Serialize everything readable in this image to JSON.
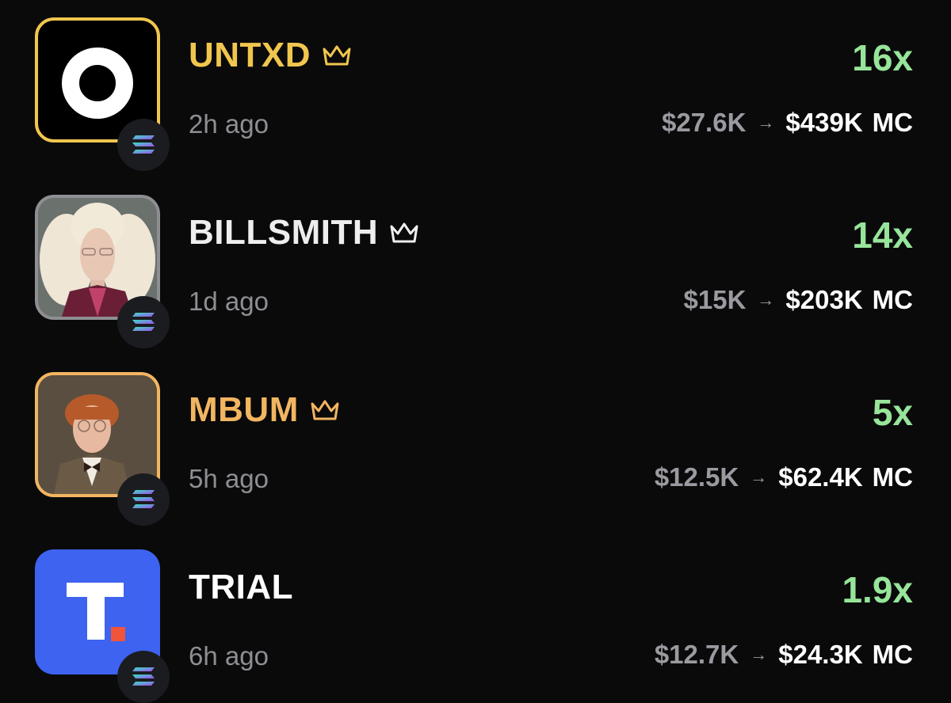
{
  "colors": {
    "gold": "#f0c64e",
    "orange": "#f2b560",
    "green": "#97e59a",
    "muted": "#8e8e93",
    "background": "#0a0a0b",
    "trial_blue": "#3d63f0",
    "trial_accent": "#f0553a"
  },
  "tokens": [
    {
      "name": "UNTXD",
      "time": "2h ago",
      "multiplier": "16x",
      "from_mc": "$27.6K",
      "arrow": "→",
      "to_mc": "$439K",
      "unit": "MC",
      "has_crown": true,
      "name_color": "#f0c64e",
      "border_color": "#f0c64e",
      "avatar": "ring-logo-icon"
    },
    {
      "name": "BILLSMITH",
      "time": "1d ago",
      "multiplier": "14x",
      "from_mc": "$15K",
      "arrow": "→",
      "to_mc": "$203K",
      "unit": "MC",
      "has_crown": true,
      "name_color": "#eeeeee",
      "border_color": "#8e8e93",
      "avatar": "portrait-white-hair"
    },
    {
      "name": "MBUM",
      "time": "5h ago",
      "multiplier": "5x",
      "from_mc": "$12.5K",
      "arrow": "→",
      "to_mc": "$62.4K",
      "unit": "MC",
      "has_crown": true,
      "name_color": "#f2b560",
      "border_color": "#f2b560",
      "avatar": "portrait-red-hair"
    },
    {
      "name": "TRIAL",
      "time": "6h ago",
      "multiplier": "1.9x",
      "from_mc": "$12.7K",
      "arrow": "→",
      "to_mc": "$24.3K",
      "unit": "MC",
      "has_crown": false,
      "name_color": "#ffffff",
      "border_color": "none",
      "avatar": "t-logo-icon"
    }
  ],
  "chain_icon": "solana-icon"
}
